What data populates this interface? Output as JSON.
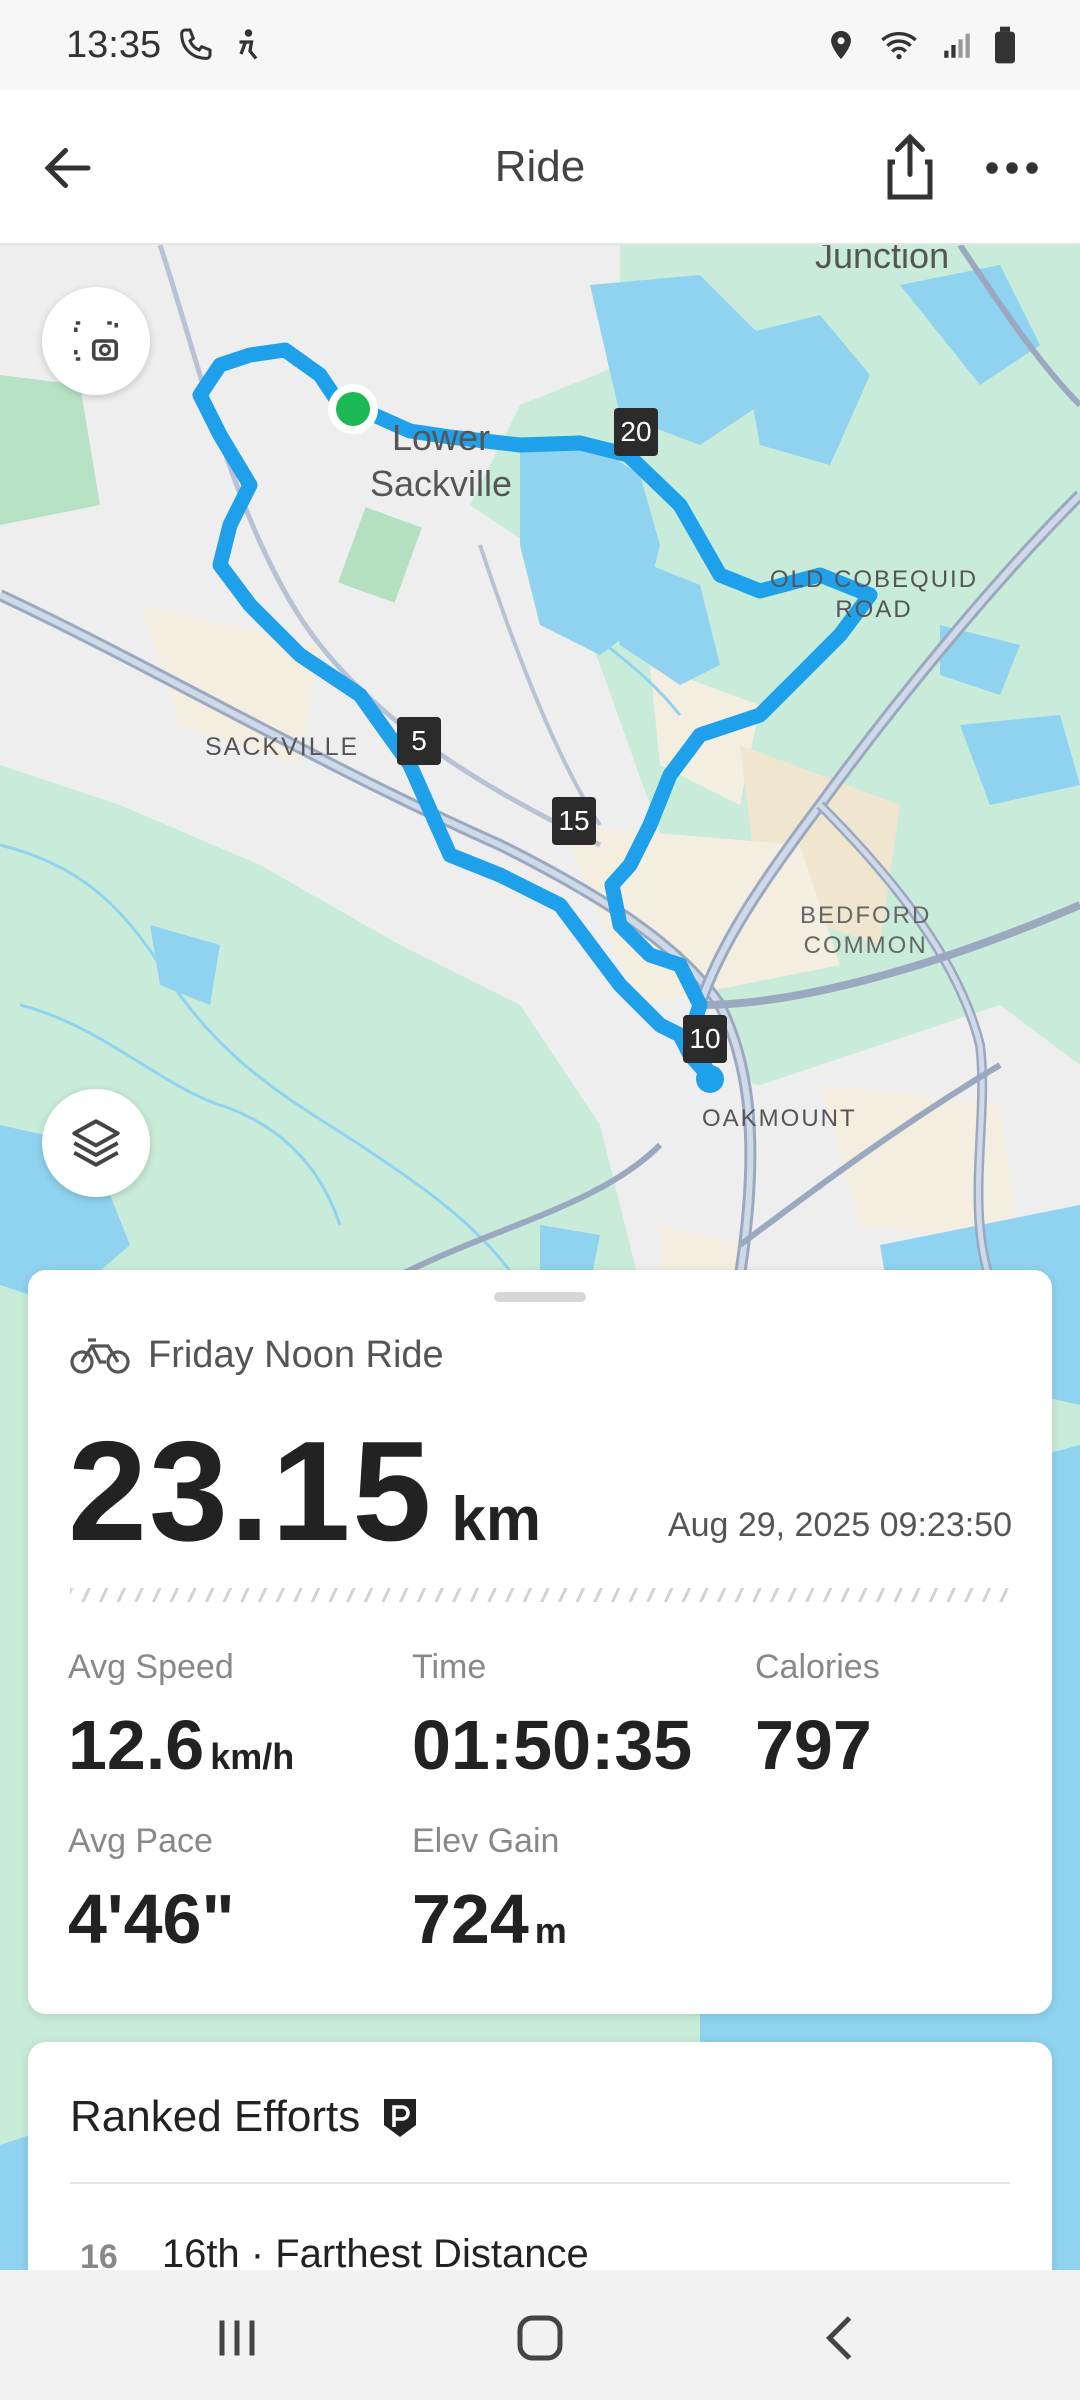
{
  "status_bar": {
    "time": "13:35",
    "icons": [
      "phone-icon",
      "accessibility-icon",
      "location-icon",
      "wifi-icon",
      "signal-icon",
      "battery-icon"
    ]
  },
  "app_bar": {
    "title": "Ride",
    "back_icon": "arrow-left-icon",
    "share_icon": "share-icon",
    "more_icon": "more-horizontal-icon"
  },
  "map": {
    "labels": {
      "junction": "Junction",
      "lower_sackville": "Lower\nSackville",
      "old_cobequid_road": "OLD COBEQUID\nROAD",
      "sackville": "SACKVILLE",
      "bedford_common": "BEDFORD\nCOMMON",
      "oakmount": "OAKMOUNT"
    },
    "km_markers": [
      "5",
      "10",
      "15",
      "20"
    ],
    "route_color": "#1fa0ea",
    "start_color": "#1db954",
    "buttons": {
      "screenshot_icon": "map-screenshot-icon",
      "layers_icon": "layers-icon"
    }
  },
  "summary": {
    "activity_icon": "bicycle-icon",
    "ride_name": "Friday Noon Ride",
    "distance_value": "23.15",
    "distance_unit": "km",
    "date": "Aug 29, 2025 09:23:50",
    "stats": {
      "avg_speed": {
        "label": "Avg Speed",
        "value": "12.6",
        "unit": "km/h"
      },
      "time": {
        "label": "Time",
        "value": "01:50:35"
      },
      "calories": {
        "label": "Calories",
        "value": "797"
      },
      "avg_pace": {
        "label": "Avg Pace",
        "value": "4'46\""
      },
      "elev_gain": {
        "label": "Elev Gain",
        "value": "724",
        "unit": "m"
      }
    }
  },
  "ranked_efforts": {
    "title": "Ranked Efforts",
    "badge_icon": "ranking-badge-icon",
    "items": [
      {
        "rank": "16",
        "text": "16th · Farthest Distance"
      }
    ]
  },
  "nav_bar": {
    "icons": [
      "recent-apps-icon",
      "home-icon",
      "back-icon"
    ]
  }
}
